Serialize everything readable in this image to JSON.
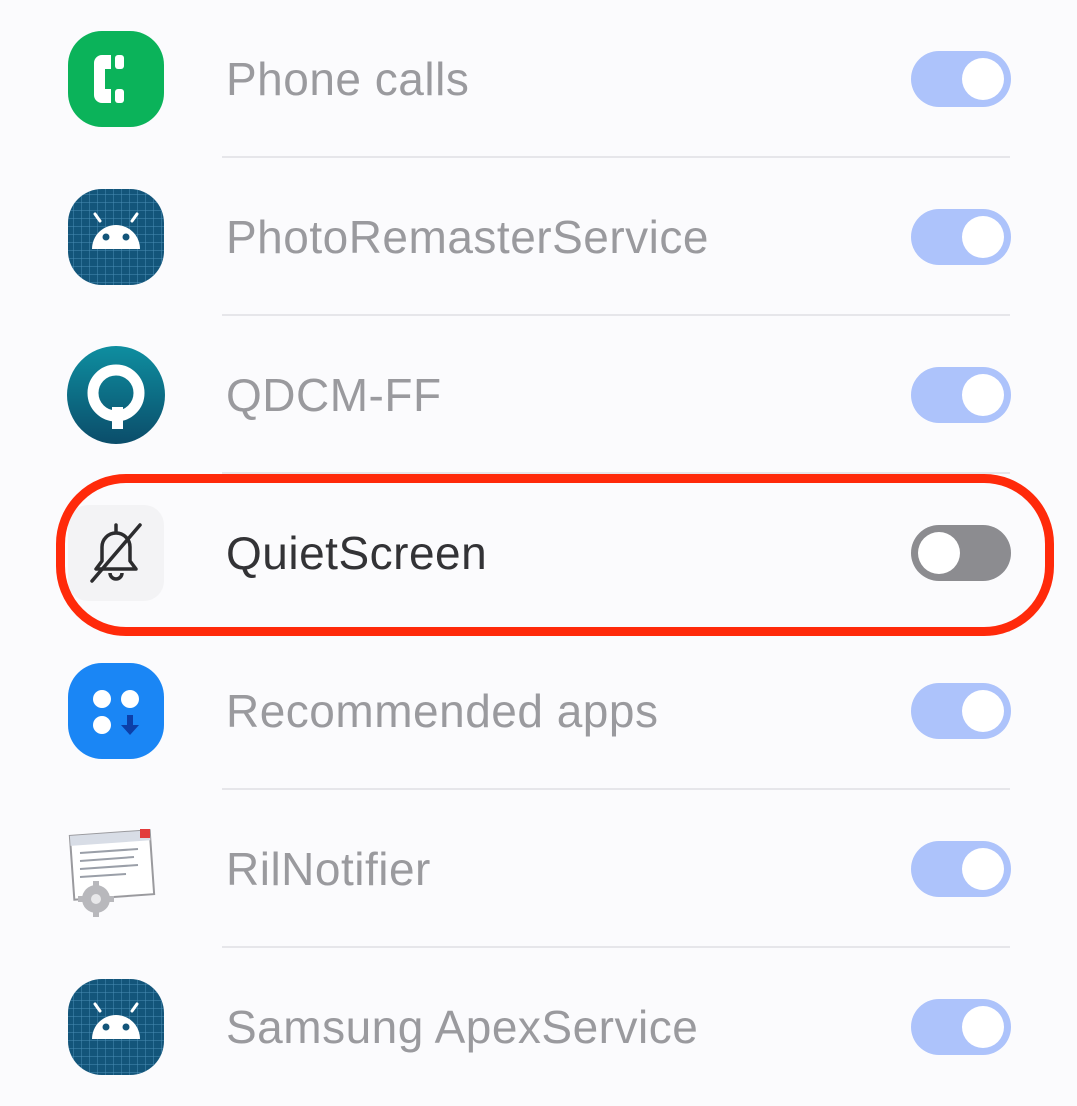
{
  "apps": [
    {
      "label": "Phone calls",
      "icon": "phone-icon",
      "toggle_on": true,
      "dimmed": true
    },
    {
      "label": "PhotoRemasterService",
      "icon": "android-icon",
      "toggle_on": true,
      "dimmed": true
    },
    {
      "label": "QDCM-FF",
      "icon": "qualcomm-icon",
      "toggle_on": true,
      "dimmed": true
    },
    {
      "label": "QuietScreen",
      "icon": "bell-off-icon",
      "toggle_on": false,
      "dimmed": false
    },
    {
      "label": "Recommended apps",
      "icon": "recommended-apps-icon",
      "toggle_on": true,
      "dimmed": true
    },
    {
      "label": "RilNotifier",
      "icon": "ril-notifier-icon",
      "toggle_on": true,
      "dimmed": true
    },
    {
      "label": "Samsung ApexService",
      "icon": "android-icon",
      "toggle_on": true,
      "dimmed": true
    }
  ],
  "colors": {
    "toggle_on_dimmed": "#adc3fb",
    "toggle_off": "#8c8c90",
    "highlight": "#ff2a0a",
    "phone_green": "#0bb35a",
    "android_teal": "#13557a",
    "qualcomm_teal": "#0d7c8c",
    "recommended_blue": "#1a86f5"
  }
}
